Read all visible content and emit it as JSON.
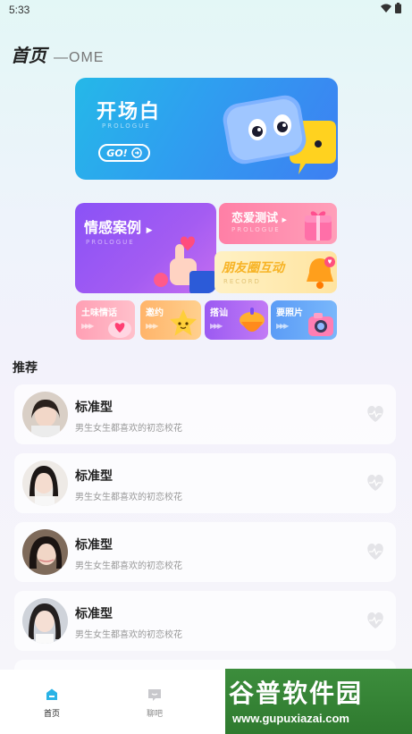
{
  "status_bar": {
    "time": "5:33"
  },
  "header": {
    "title": "首页",
    "subtitle": "—OME"
  },
  "banner": {
    "title": "开场白",
    "subtitle": "PROLOGUE",
    "button_label": "GO!"
  },
  "feature_cards": {
    "case": {
      "title": "情感案例",
      "subtitle": "PROLOGUE"
    },
    "love_test": {
      "title": "恋爱测试",
      "subtitle": "PROLOGUE"
    },
    "moments": {
      "title": "朋友圈互动",
      "subtitle": "RECORD"
    }
  },
  "small_cards": [
    {
      "label": "土味情话"
    },
    {
      "label": "邀约"
    },
    {
      "label": "搭讪"
    },
    {
      "label": "要照片"
    }
  ],
  "recommend": {
    "section_title": "推荐",
    "items": [
      {
        "name": "标准型",
        "desc": "男生女生都喜欢的初恋校花"
      },
      {
        "name": "标准型",
        "desc": "男生女生都喜欢的初恋校花"
      },
      {
        "name": "标准型",
        "desc": "男生女生都喜欢的初恋校花"
      },
      {
        "name": "标准型",
        "desc": "男生女生都喜欢的初恋校花"
      }
    ]
  },
  "tabbar": {
    "home_label": "首页",
    "chat_label": "聊吧"
  },
  "watermark": {
    "line1": "谷普软件园",
    "line2": "www.gupuxiazai.com"
  },
  "colors": {
    "accent_blue": "#2f9ef0",
    "accent_purple": "#8a52f6",
    "accent_pink": "#ff7fa6",
    "tab_active": "#2ab3e6"
  }
}
